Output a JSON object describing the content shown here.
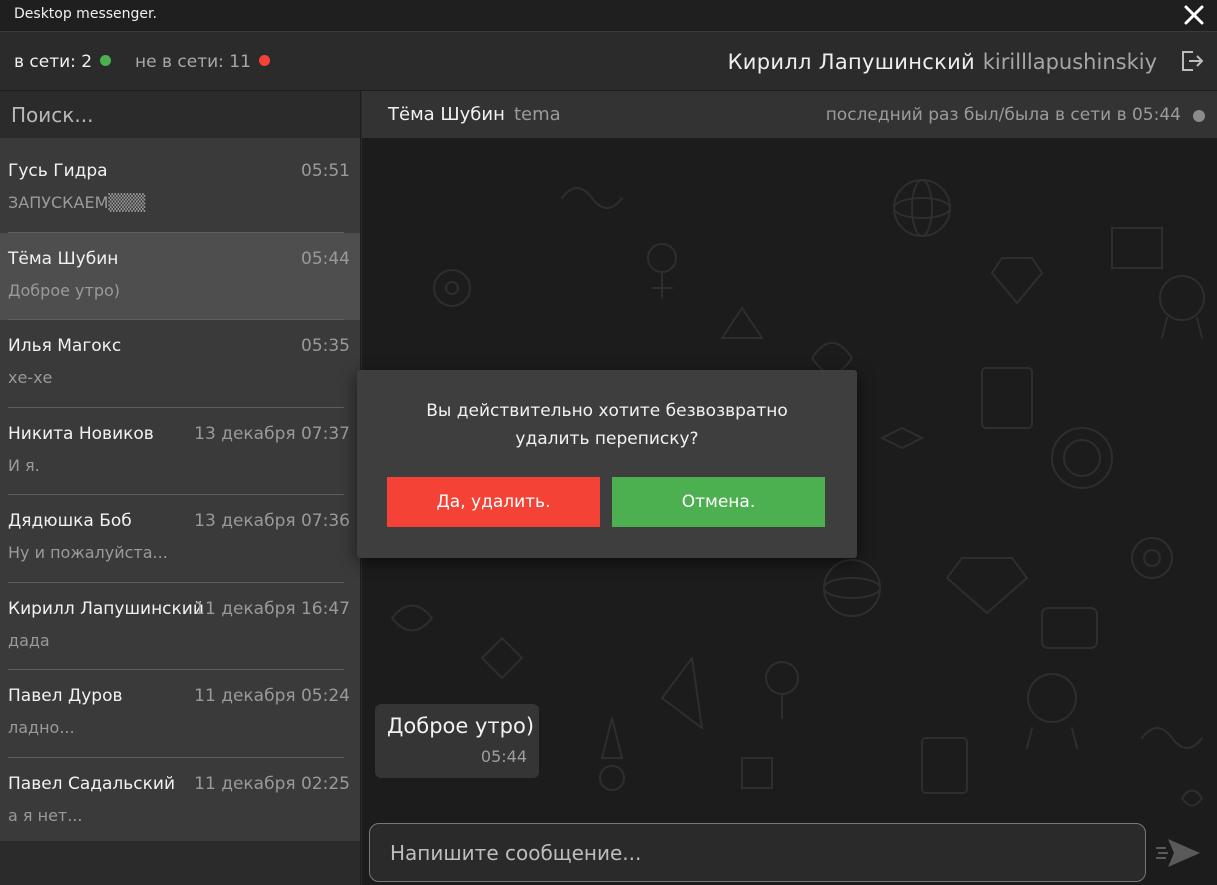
{
  "window": {
    "title": "Desktop messenger."
  },
  "topbar": {
    "online_label": "в сети: 2",
    "offline_label": "не в сети: 11",
    "user_name": "Кирилл Лапушинский",
    "user_login": "kirilllapushinskiy"
  },
  "colors": {
    "online": "#4caf50",
    "offline": "#f44336",
    "danger": "#f44336",
    "confirm": "#4caf50"
  },
  "sidebar": {
    "search_placeholder": "Поиск...",
    "chats": [
      {
        "name": "Гусь Гидра",
        "time": "05:51",
        "preview": "ЗАПУСКАЕМ▒▒▒",
        "active": false
      },
      {
        "name": "Тёма Шубин",
        "time": "05:44",
        "preview": "Доброе утро)",
        "active": true
      },
      {
        "name": "Илья Магокс",
        "time": "05:35",
        "preview": "хе-хе",
        "active": false
      },
      {
        "name": "Никита Новиков",
        "time": "13 декабря 07:37",
        "preview": "И я.",
        "active": false
      },
      {
        "name": "Дядюшка Боб",
        "time": "13 декабря 07:36",
        "preview": "Ну и пожалуйста...",
        "active": false
      },
      {
        "name": "Кирилл Лапушинский",
        "time": "11 декабря 16:47",
        "preview": "дада",
        "active": false
      },
      {
        "name": "Павел Дуров",
        "time": "11 декабря 05:24",
        "preview": "ладно...",
        "active": false
      },
      {
        "name": "Павел Садальский",
        "time": "11 декабря 02:25",
        "preview": "а я нет...",
        "active": false
      }
    ]
  },
  "chat": {
    "name": "Тёма Шубин",
    "login": "tema",
    "last_seen": "последний раз был/была в сети в 05:44",
    "messages": [
      {
        "text": "Доброе утро)",
        "time": "05:44"
      }
    ],
    "input_placeholder": "Напишите сообщение..."
  },
  "dialog": {
    "question": "Вы действительно хотите безвозвратно\nудалить переписку?",
    "confirm_label": "Да, удалить.",
    "cancel_label": "Отмена."
  }
}
